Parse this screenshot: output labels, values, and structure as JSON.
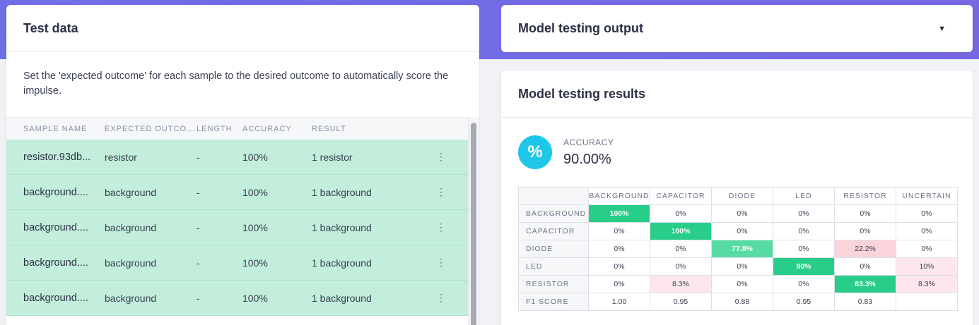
{
  "test_data": {
    "title": "Test data",
    "description": "Set the 'expected outcome' for each sample to the desired outcome to automatically score the impulse.",
    "columns": [
      "SAMPLE NAME",
      "EXPECTED OUTCO...",
      "LENGTH",
      "ACCURACY",
      "RESULT"
    ],
    "rows": [
      {
        "name": "resistor.93db...",
        "expected": "resistor",
        "length": "-",
        "accuracy": "100%",
        "result": "1 resistor"
      },
      {
        "name": "background....",
        "expected": "background",
        "length": "-",
        "accuracy": "100%",
        "result": "1 background"
      },
      {
        "name": "background....",
        "expected": "background",
        "length": "-",
        "accuracy": "100%",
        "result": "1 background"
      },
      {
        "name": "background....",
        "expected": "background",
        "length": "-",
        "accuracy": "100%",
        "result": "1 background"
      },
      {
        "name": "background....",
        "expected": "background",
        "length": "-",
        "accuracy": "100%",
        "result": "1 background"
      }
    ]
  },
  "output": {
    "title": "Model testing output"
  },
  "results": {
    "title": "Model testing results",
    "accuracy_label": "ACCURACY",
    "accuracy_value": "90.00%",
    "icon": "percent-icon",
    "matrix": {
      "columns": [
        "BACKGROUND",
        "CAPACITOR",
        "DIODE",
        "LED",
        "RESISTOR",
        "UNCERTAIN"
      ],
      "rows": [
        {
          "label": "BACKGROUND",
          "cells": [
            "100%",
            "0%",
            "0%",
            "0%",
            "0%",
            "0%"
          ]
        },
        {
          "label": "CAPACITOR",
          "cells": [
            "0%",
            "100%",
            "0%",
            "0%",
            "0%",
            "0%"
          ]
        },
        {
          "label": "DIODE",
          "cells": [
            "0%",
            "0%",
            "77.8%",
            "0%",
            "22.2%",
            "0%"
          ]
        },
        {
          "label": "LED",
          "cells": [
            "0%",
            "0%",
            "0%",
            "90%",
            "0%",
            "10%"
          ]
        },
        {
          "label": "RESISTOR",
          "cells": [
            "0%",
            "8.3%",
            "0%",
            "0%",
            "83.3%",
            "8.3%"
          ]
        },
        {
          "label": "F1 SCORE",
          "cells": [
            "1.00",
            "0.95",
            "0.88",
            "0.95",
            "0.83",
            ""
          ]
        }
      ]
    },
    "colors": {
      "high": "#28cd8a",
      "mid": "#57dba4",
      "error": "#fad3db",
      "error_light": "#fde7ec"
    }
  }
}
